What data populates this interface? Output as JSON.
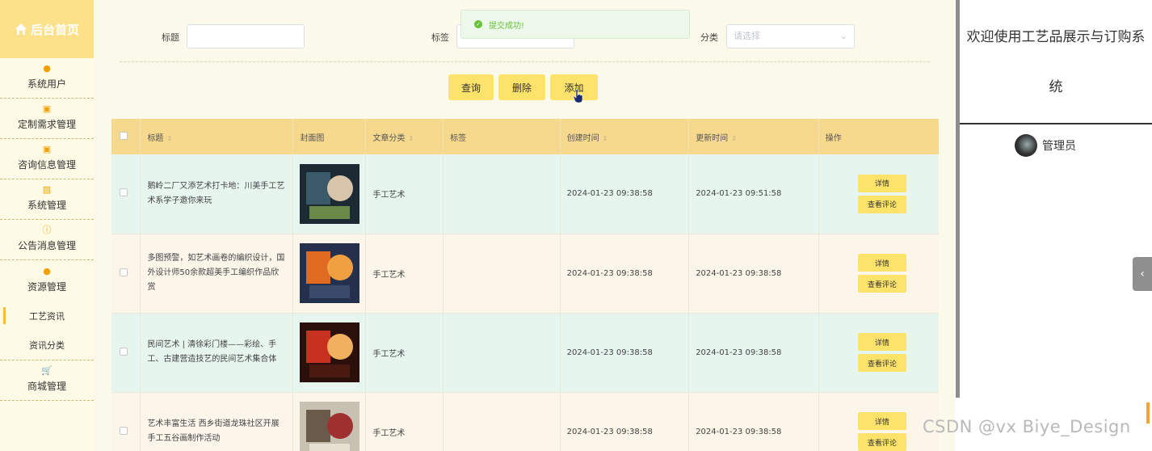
{
  "sidebar": {
    "logo": "后台首页",
    "items": [
      {
        "icon": "user-icon",
        "label": "系统用户"
      },
      {
        "icon": "edit-icon",
        "label": "定制需求管理"
      },
      {
        "icon": "edit-icon",
        "label": "咨询信息管理"
      },
      {
        "icon": "image-icon",
        "label": "系统管理"
      },
      {
        "icon": "info-icon",
        "label": "公告消息管理"
      },
      {
        "icon": "location-icon",
        "label": "资源管理"
      }
    ],
    "subitems": [
      {
        "label": "工艺资讯",
        "active": true
      },
      {
        "label": "资讯分类",
        "active": false
      }
    ],
    "shop": {
      "icon": "cart-icon",
      "label": "商城管理"
    }
  },
  "search": {
    "title_label": "标题",
    "tag_label": "标签",
    "category_label": "分类",
    "category_placeholder": "请选择"
  },
  "toast": {
    "message": "提交成功!"
  },
  "actions": {
    "query": "查询",
    "delete": "删除",
    "add": "添加"
  },
  "table": {
    "headers": [
      "标题",
      "封面图",
      "文章分类",
      "标签",
      "创建时间",
      "更新时间",
      "操作"
    ],
    "rows": [
      {
        "title": "鹅岭二厂又添艺术打卡地：川美手工艺术系学子邀你来玩",
        "category": "手工艺术",
        "tag": "",
        "created": "2024-01-23 09:38:58",
        "updated": "2024-01-23 09:51:58"
      },
      {
        "title": "多图预警，如艺术画卷的编织设计，国外设计师50余款超美手工编织作品欣赏",
        "category": "手工艺术",
        "tag": "",
        "created": "2024-01-23 09:38:58",
        "updated": "2024-01-23 09:38:58"
      },
      {
        "title": "民间艺术 | 清徐彩门楼——彩绘、手工、古建营造技艺的民间艺术集合体",
        "category": "手工艺术",
        "tag": "",
        "created": "2024-01-23 09:38:58",
        "updated": "2024-01-23 09:38:58"
      },
      {
        "title": "艺术丰富生活 西乡街道龙珠社区开展手工五谷画制作活动",
        "category": "手工艺术",
        "tag": "",
        "created": "2024-01-23 09:38:58",
        "updated": "2024-01-23 09:38:58"
      }
    ],
    "detail_label": "详情",
    "comments_label": "查看评论"
  },
  "right": {
    "welcome_line1": "欢迎使用工艺品展示与订购系",
    "welcome_line2": "统",
    "user_name": "管理员"
  },
  "watermark": "CSDN @vx Biye_Design"
}
